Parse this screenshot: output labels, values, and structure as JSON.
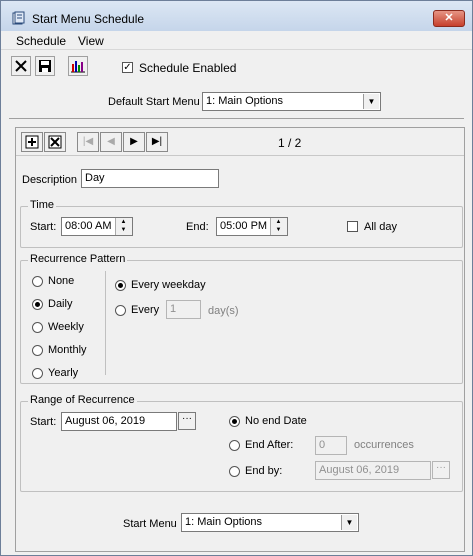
{
  "window": {
    "title": "Start Menu Schedule",
    "close_label": "✕"
  },
  "menubar": [
    "Schedule",
    "View"
  ],
  "toolbar": {
    "schedule_enabled_label": "Schedule Enabled",
    "schedule_enabled_checked": true
  },
  "default_start_menu": {
    "label": "Default Start Menu",
    "value": "1: Main Options"
  },
  "navigator": {
    "position": "1 / 2"
  },
  "description": {
    "label": "Description",
    "value": "Day"
  },
  "time": {
    "group_label": "Time",
    "start_label": "Start:",
    "start_value": "08:00 AM",
    "end_label": "End:",
    "end_value": "05:00 PM",
    "all_day_label": "All day",
    "all_day_checked": false
  },
  "recurrence": {
    "group_label": "Recurrence Pattern",
    "options": [
      "None",
      "Daily",
      "Weekly",
      "Monthly",
      "Yearly"
    ],
    "selected": "Daily",
    "every_weekday_label": "Every weekday",
    "every_label": "Every",
    "every_value": "1",
    "days_unit": "day(s)"
  },
  "range": {
    "group_label": "Range of Recurrence",
    "start_label": "Start:",
    "start_value": "August 06, 2019",
    "no_end_label": "No end Date",
    "end_after_label": "End After:",
    "end_after_value": "0",
    "occurrences_label": "occurrences",
    "end_by_label": "End by:",
    "end_by_value": "August 06, 2019",
    "selected": "No end Date"
  },
  "start_menu": {
    "label": "Start Menu",
    "value": "1: Main Options"
  },
  "colors": {
    "title_bg": "#c5d5ea",
    "close_red": "#c7402c",
    "window_bg": "#f0f0f0"
  }
}
